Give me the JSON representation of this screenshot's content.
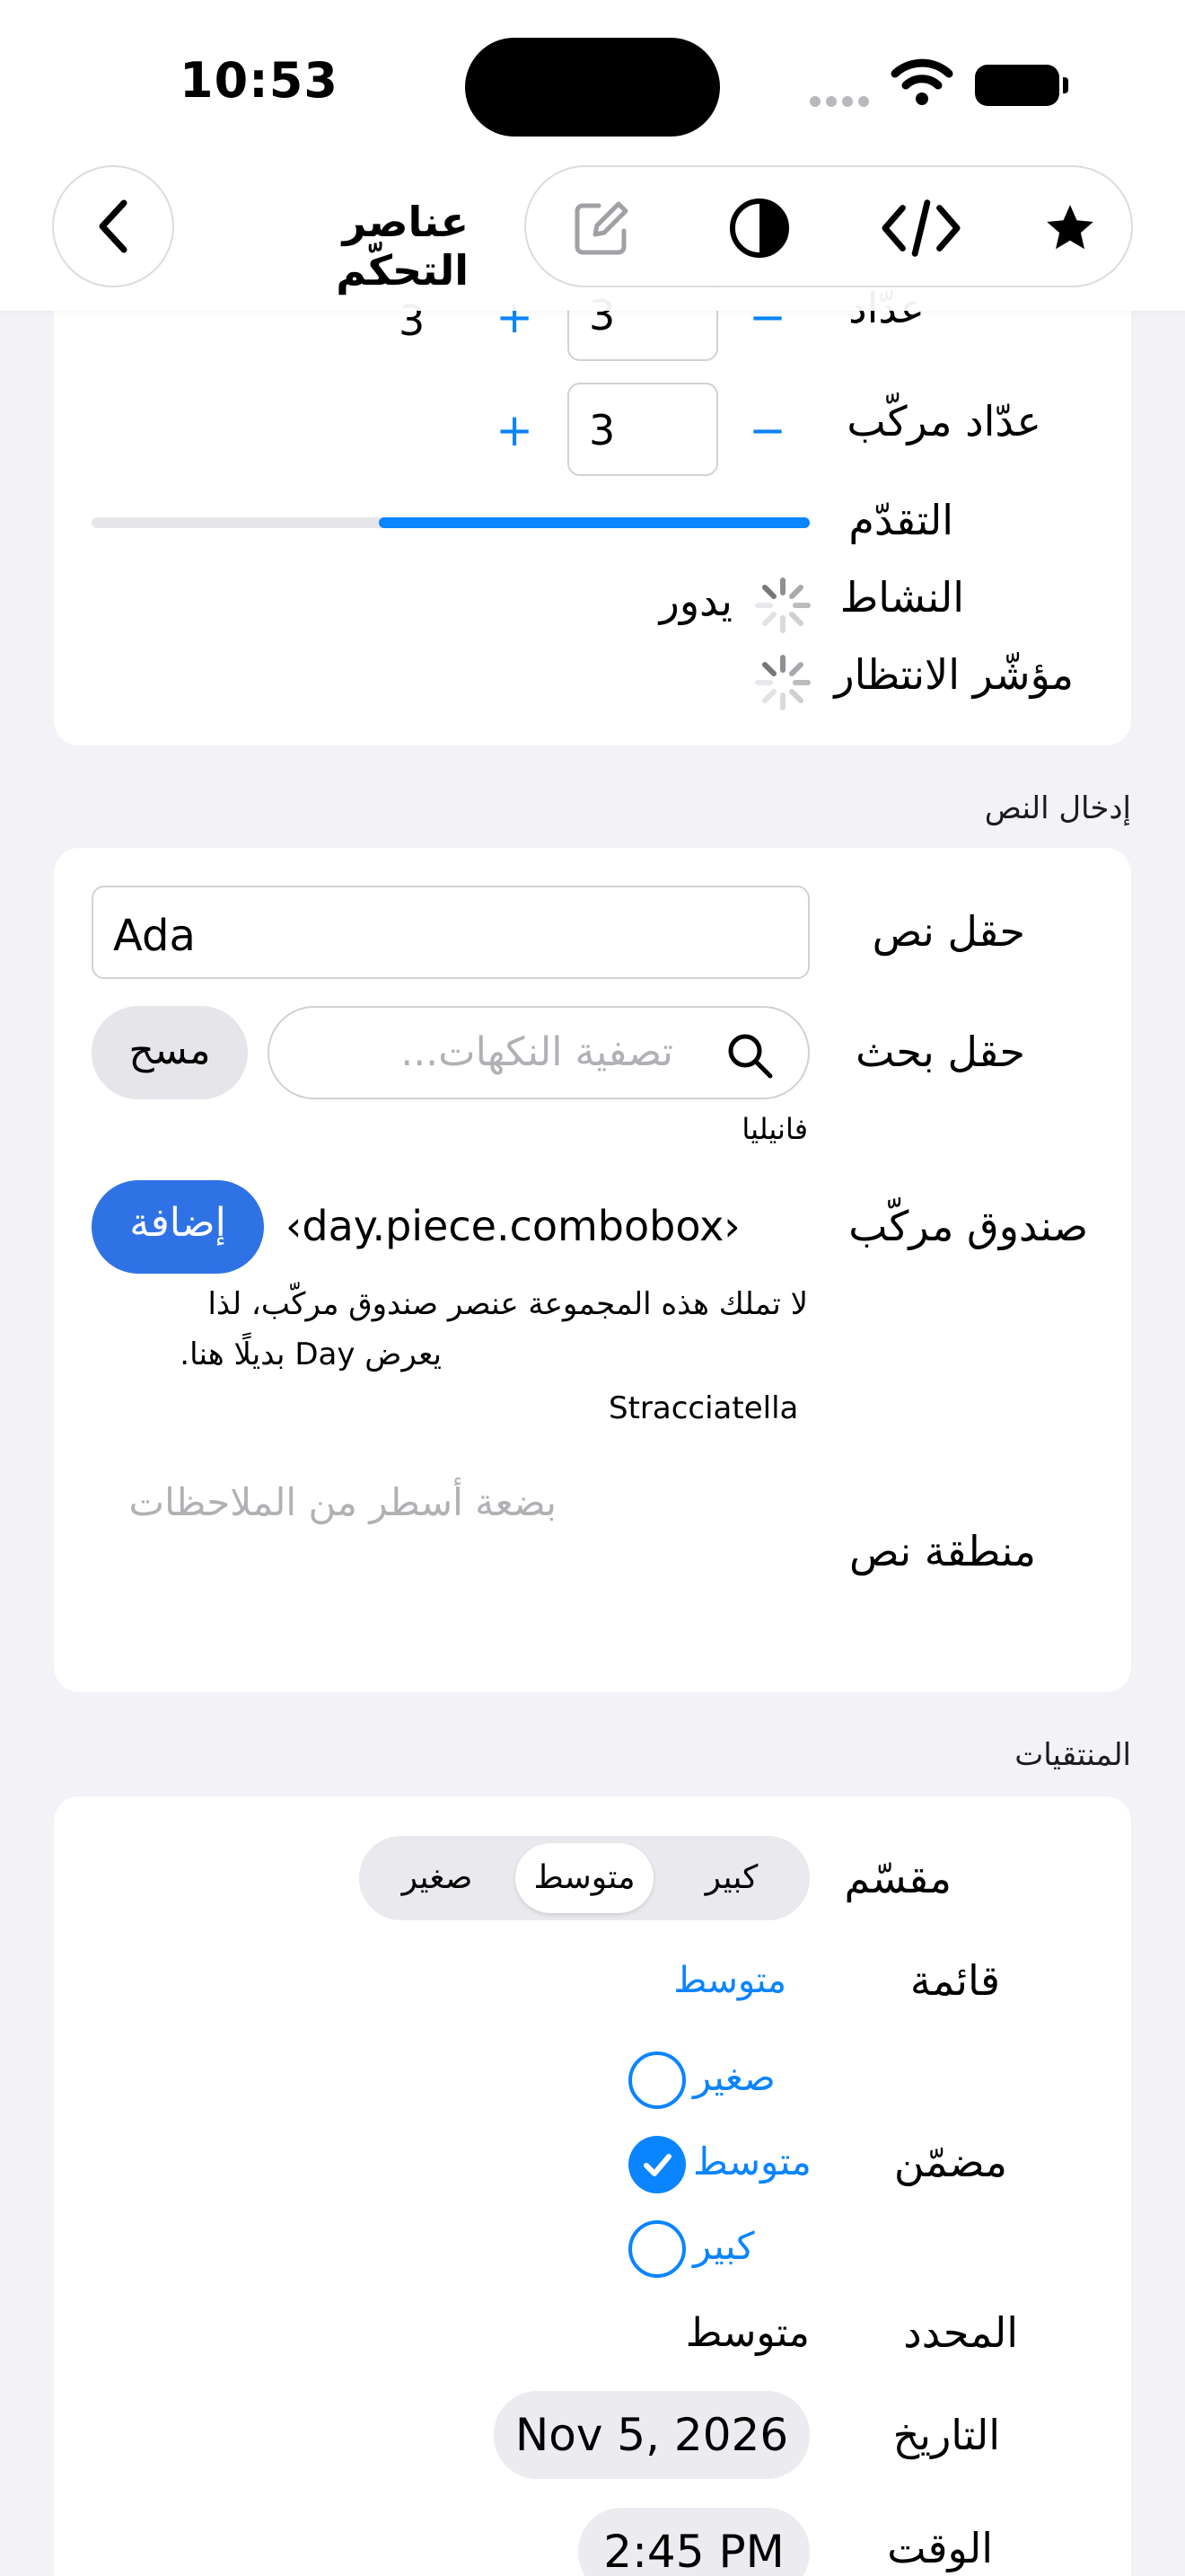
{
  "status_bar": {
    "time": "10:53"
  },
  "nav": {
    "title": "عناصر التحكّم"
  },
  "steppers": {
    "counter_label": "عدّاد",
    "counter_value": "3",
    "counter_display": "3",
    "compound_label": "عدّاد مركّب",
    "compound_value": "3",
    "minus": "−",
    "plus": "+"
  },
  "progress": {
    "label": "التقدّم",
    "value": 0.6
  },
  "activity": {
    "label": "النشاط",
    "state": "يدور"
  },
  "wait_indicator": {
    "label": "مؤشّر الانتظار"
  },
  "text_input_section": {
    "title": "إدخال النص",
    "textfield_label": "حقل نص",
    "textfield_value": "Ada",
    "search_label": "حقل بحث",
    "search_placeholder": "تصفية النكهات...",
    "clear_label": "مسح",
    "search_result": "فانيليا",
    "combobox_label": "صندوق مركّب",
    "combobox_value": "‹day.piece.combobox›",
    "add_label": "إضافة",
    "combobox_note_line1": "لا تملك هذه المجموعة عنصر صندوق مركّب، لذا",
    "combobox_note_line2": "يعرض Day بديلًا هنا.",
    "combobox_selected": "Stracciatella",
    "textarea_label": "منطقة نص",
    "textarea_placeholder": "بضعة أسطر من الملاحظات"
  },
  "pickers_section": {
    "title": "المنتقيات",
    "segmented_label": "مقسّم",
    "segments": [
      "كبير",
      "متوسط",
      "صغير"
    ],
    "segment_selected": "متوسط",
    "menu_label": "قائمة",
    "menu_value": "متوسط",
    "inline_label": "مضمّن",
    "inline_options": [
      "صغير",
      "متوسط",
      "كبير"
    ],
    "inline_selected": "متوسط",
    "selected_label": "المحدد",
    "selected_value": "متوسط",
    "date_label": "التاريخ",
    "date_value": "Nov 5, 2026",
    "time_label": "الوقت",
    "time_value": "2:45 PM"
  }
}
